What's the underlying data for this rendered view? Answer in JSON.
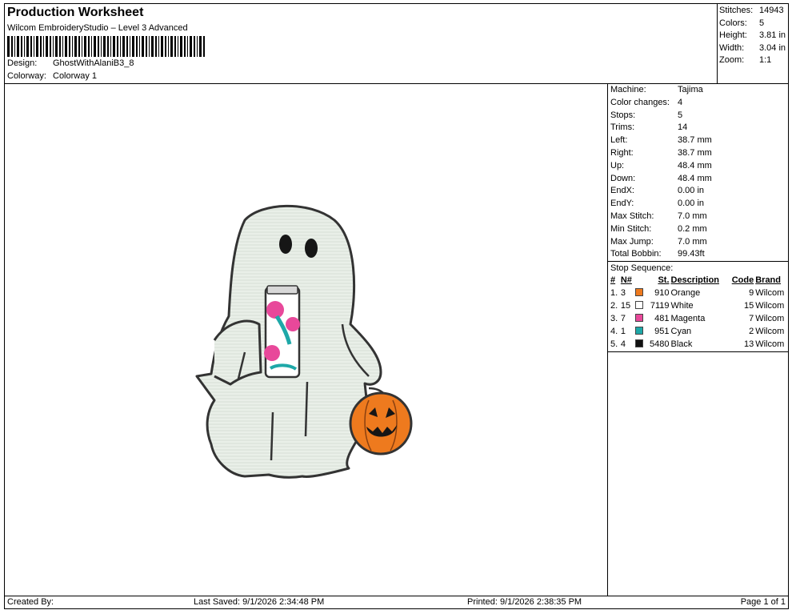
{
  "header": {
    "title": "Production Worksheet",
    "subtitle": "Wilcom EmbroideryStudio – Level 3 Advanced",
    "design_label": "Design:",
    "design_value": "GhostWithAlaniB3_8",
    "colorway_label": "Colorway:",
    "colorway_value": "Colorway 1"
  },
  "summary": [
    {
      "label": "Stitches:",
      "value": "14943"
    },
    {
      "label": "Colors:",
      "value": "5"
    },
    {
      "label": "Height:",
      "value": "3.81 in"
    },
    {
      "label": "Width:",
      "value": "3.04 in"
    },
    {
      "label": "Zoom:",
      "value": "1:1"
    }
  ],
  "stats": [
    {
      "label": "Machine:",
      "value": "Tajima"
    },
    {
      "label": "Color changes:",
      "value": "4"
    },
    {
      "label": "Stops:",
      "value": "5"
    },
    {
      "label": "Trims:",
      "value": "14"
    },
    {
      "label": "Left:",
      "value": "38.7 mm"
    },
    {
      "label": "Right:",
      "value": "38.7 mm"
    },
    {
      "label": "Up:",
      "value": "48.4 mm"
    },
    {
      "label": "Down:",
      "value": "48.4 mm"
    },
    {
      "label": "EndX:",
      "value": "0.00 in"
    },
    {
      "label": "EndY:",
      "value": "0.00 in"
    },
    {
      "label": "Max Stitch:",
      "value": "7.0 mm"
    },
    {
      "label": "Min Stitch:",
      "value": "0.2 mm"
    },
    {
      "label": "Max Jump:",
      "value": "7.0 mm"
    },
    {
      "label": "Total Bobbin:",
      "value": "99.43ft"
    }
  ],
  "stop_sequence": {
    "title": "Stop Sequence:",
    "headers": {
      "num": "#",
      "n": "N#",
      "st": "St.",
      "desc": "Description",
      "code": "Code",
      "brand": "Brand"
    },
    "rows": [
      {
        "num": "1.",
        "n": "3",
        "color": "#ee7a1e",
        "st": "910",
        "desc": "Orange",
        "code": "9",
        "brand": "Wilcom"
      },
      {
        "num": "2.",
        "n": "15",
        "color": "#ffffff",
        "st": "7119",
        "desc": "White",
        "code": "15",
        "brand": "Wilcom"
      },
      {
        "num": "3.",
        "n": "7",
        "color": "#e8489a",
        "st": "481",
        "desc": "Magenta",
        "code": "7",
        "brand": "Wilcom"
      },
      {
        "num": "4.",
        "n": "1",
        "color": "#1ea8a8",
        "st": "951",
        "desc": "Cyan",
        "code": "2",
        "brand": "Wilcom"
      },
      {
        "num": "5.",
        "n": "4",
        "color": "#111111",
        "st": "5480",
        "desc": "Black",
        "code": "13",
        "brand": "Wilcom"
      }
    ]
  },
  "footer": {
    "created_by": "Created By:",
    "last_saved": "Last Saved: 9/1/2026 2:34:48 PM",
    "printed": "Printed: 9/1/2026 2:38:35 PM",
    "page": "Page 1 of 1"
  }
}
